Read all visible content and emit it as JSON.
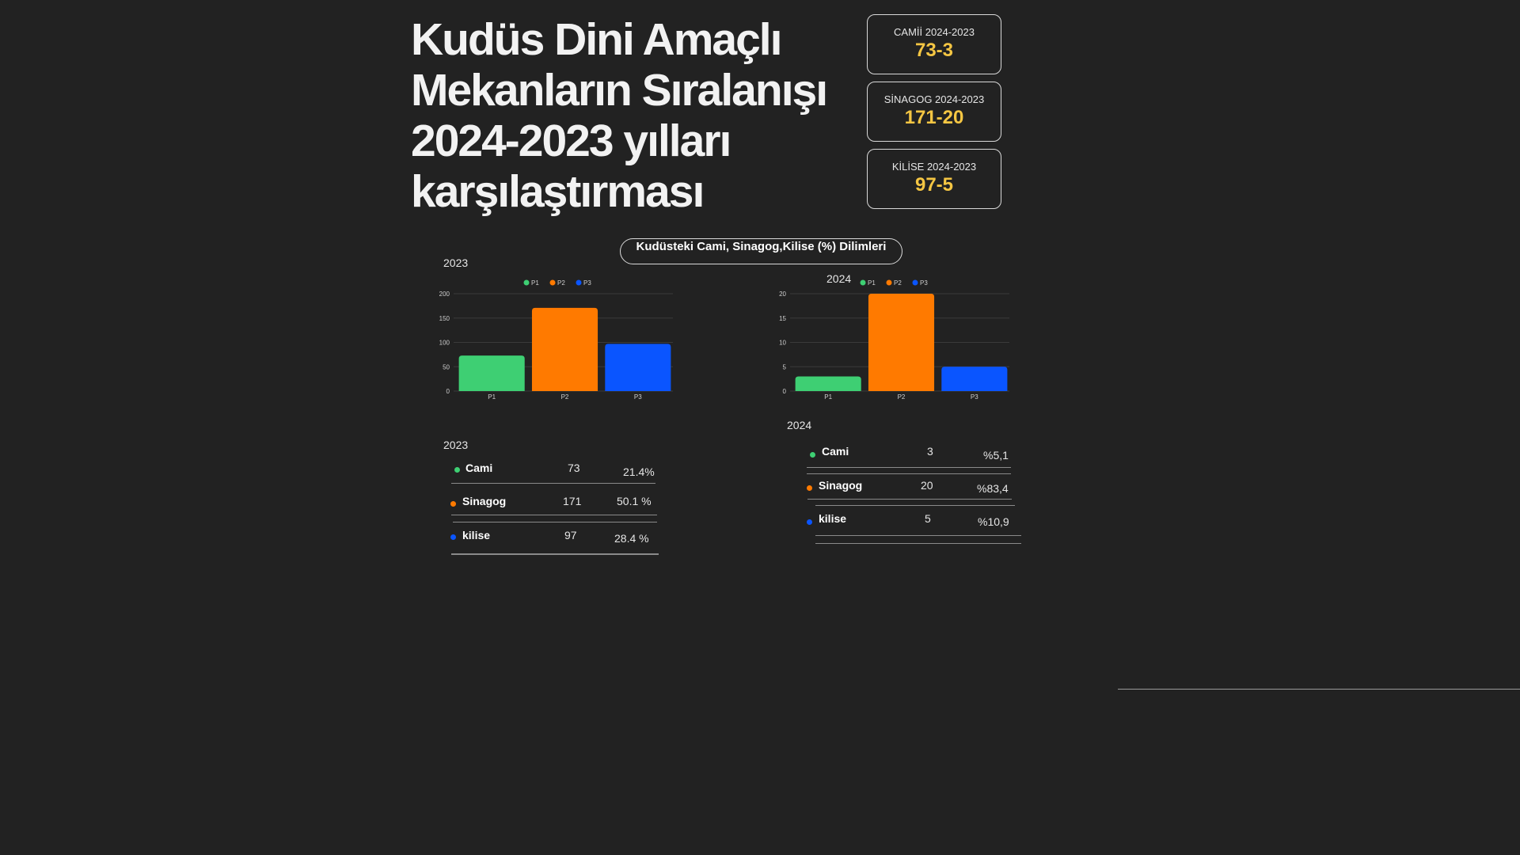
{
  "title": "Kudüs Dini Amaçlı Mekanların Sıralanışı 2024-2023 yılları karşılaştırması",
  "stats": [
    {
      "label": "CAMİİ 2024-2023",
      "value": "73-3"
    },
    {
      "label": "SİNAGOG 2024-2023",
      "value": "171-20"
    },
    {
      "label": "KİLİSE 2024-2023",
      "value": "97-5"
    }
  ],
  "pill_label": "Kudüsteki  Cami, Sinagog,Kilise  (%) Dilimleri",
  "colors": {
    "P1": "#3ecf73",
    "P2": "#ff7a00",
    "P3": "#0a55ff",
    "accent": "#f5c643"
  },
  "chart_data": [
    {
      "type": "bar",
      "title": "2023",
      "categories": [
        "P1",
        "P2",
        "P3"
      ],
      "values": [
        73,
        171,
        97
      ],
      "legend": [
        "P1",
        "P2",
        "P3"
      ],
      "yticks": [
        0,
        50,
        100,
        150,
        200
      ],
      "ylim": [
        0,
        200
      ],
      "grid": true,
      "legend_position": "top-center"
    },
    {
      "type": "bar",
      "title": "2024",
      "categories": [
        "P1",
        "P2",
        "P3"
      ],
      "values": [
        3,
        20,
        5
      ],
      "legend": [
        "P1",
        "P2",
        "P3"
      ],
      "yticks": [
        0,
        5,
        10,
        15,
        20
      ],
      "ylim": [
        0,
        20
      ],
      "grid": true,
      "legend_position": "top-center"
    }
  ],
  "tables": [
    {
      "year": "2023",
      "rows": [
        {
          "name": "Cami",
          "count": "73",
          "pct": "21.4%"
        },
        {
          "name": "Sinagog",
          "count": "171",
          "pct": "50.1 %"
        },
        {
          "name": "kilise",
          "count": "97",
          "pct": "28.4 %"
        }
      ]
    },
    {
      "year": "2024",
      "rows": [
        {
          "name": "Cami",
          "count": "3",
          "pct": "%5,1"
        },
        {
          "name": "Sinagog",
          "count": "20",
          "pct": "%83,4"
        },
        {
          "name": "kilise",
          "count": "5",
          "pct": "%10,9"
        }
      ]
    }
  ]
}
